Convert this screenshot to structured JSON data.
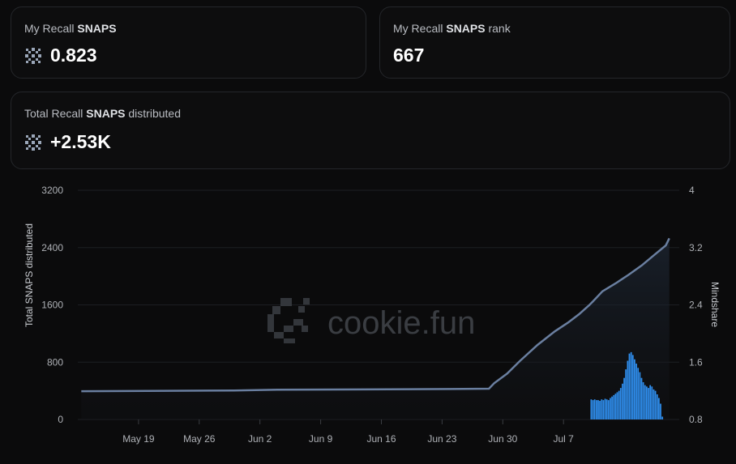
{
  "cards": {
    "my_snaps": {
      "label_pre": "My Recall ",
      "label_bold": "SNAPS",
      "label_post": "",
      "value": "0.823",
      "icon": "snaps-icon"
    },
    "my_rank": {
      "label_pre": "My Recall ",
      "label_bold": "SNAPS",
      "label_post": " rank",
      "value": "667"
    },
    "total": {
      "label_pre": "Total Recall ",
      "label_bold": "SNAPS",
      "label_post": " distributed",
      "value": "+2.53K",
      "icon": "snaps-icon"
    }
  },
  "watermark": "cookie.fun",
  "chart_data": {
    "type": "line+bar",
    "ylabel_left": "Total SNAPS distributed",
    "ylabel_right": "Mindshare",
    "yticks_left": [
      "3200",
      "2400",
      "1600",
      "800",
      "0"
    ],
    "yticks_right": [
      "4",
      "3.2",
      "2.4",
      "1.6",
      "0.8"
    ],
    "ylim_left": [
      0,
      3200
    ],
    "ylim_right": [
      0.8,
      4
    ],
    "xticks": [
      "May 19",
      "May 26",
      "Jun 2",
      "Jun 9",
      "Jun 16",
      "Jun 23",
      "Jun 30",
      "Jul 7"
    ],
    "xtick_days": [
      19,
      26,
      33,
      40,
      47,
      54,
      61,
      68
    ],
    "x_start_day": 12,
    "x_end_day": 71.5,
    "grid": true,
    "colors": {
      "line": "#6a7fa0",
      "bars": "#2f8ff0",
      "grid": "#1d1f23"
    },
    "series": [
      {
        "name": "Total SNAPS distributed",
        "axis": "left",
        "kind": "line",
        "points": [
          [
            12.4,
            395
          ],
          [
            20,
            398
          ],
          [
            30,
            405
          ],
          [
            35,
            415
          ],
          [
            45,
            420
          ],
          [
            55,
            425
          ],
          [
            59.4,
            430
          ],
          [
            60,
            505
          ],
          [
            61.5,
            640
          ],
          [
            63,
            820
          ],
          [
            65,
            1040
          ],
          [
            67,
            1230
          ],
          [
            68.5,
            1350
          ],
          [
            69.8,
            1470
          ],
          [
            71,
            1600
          ],
          [
            71.4,
            1650
          ],
          [
            72.5,
            1790
          ],
          [
            74,
            1900
          ],
          [
            75.5,
            2020
          ],
          [
            77,
            2150
          ],
          [
            78.5,
            2300
          ],
          [
            79.8,
            2430
          ],
          [
            80.2,
            2530
          ]
        ]
      },
      {
        "name": "Mindshare",
        "axis": "right",
        "kind": "bar",
        "x_start": 71.2,
        "x_step": 0.2,
        "values": [
          1.08,
          1.07,
          1.08,
          1.07,
          1.07,
          1.06,
          1.08,
          1.07,
          1.09,
          1.08,
          1.07,
          1.1,
          1.12,
          1.14,
          1.16,
          1.18,
          1.2,
          1.24,
          1.3,
          1.38,
          1.5,
          1.62,
          1.72,
          1.74,
          1.7,
          1.64,
          1.58,
          1.52,
          1.46,
          1.38,
          1.32,
          1.28,
          1.26,
          1.24,
          1.28,
          1.26,
          1.22,
          1.2,
          1.15,
          1.1,
          1.02,
          0.84
        ]
      }
    ]
  }
}
